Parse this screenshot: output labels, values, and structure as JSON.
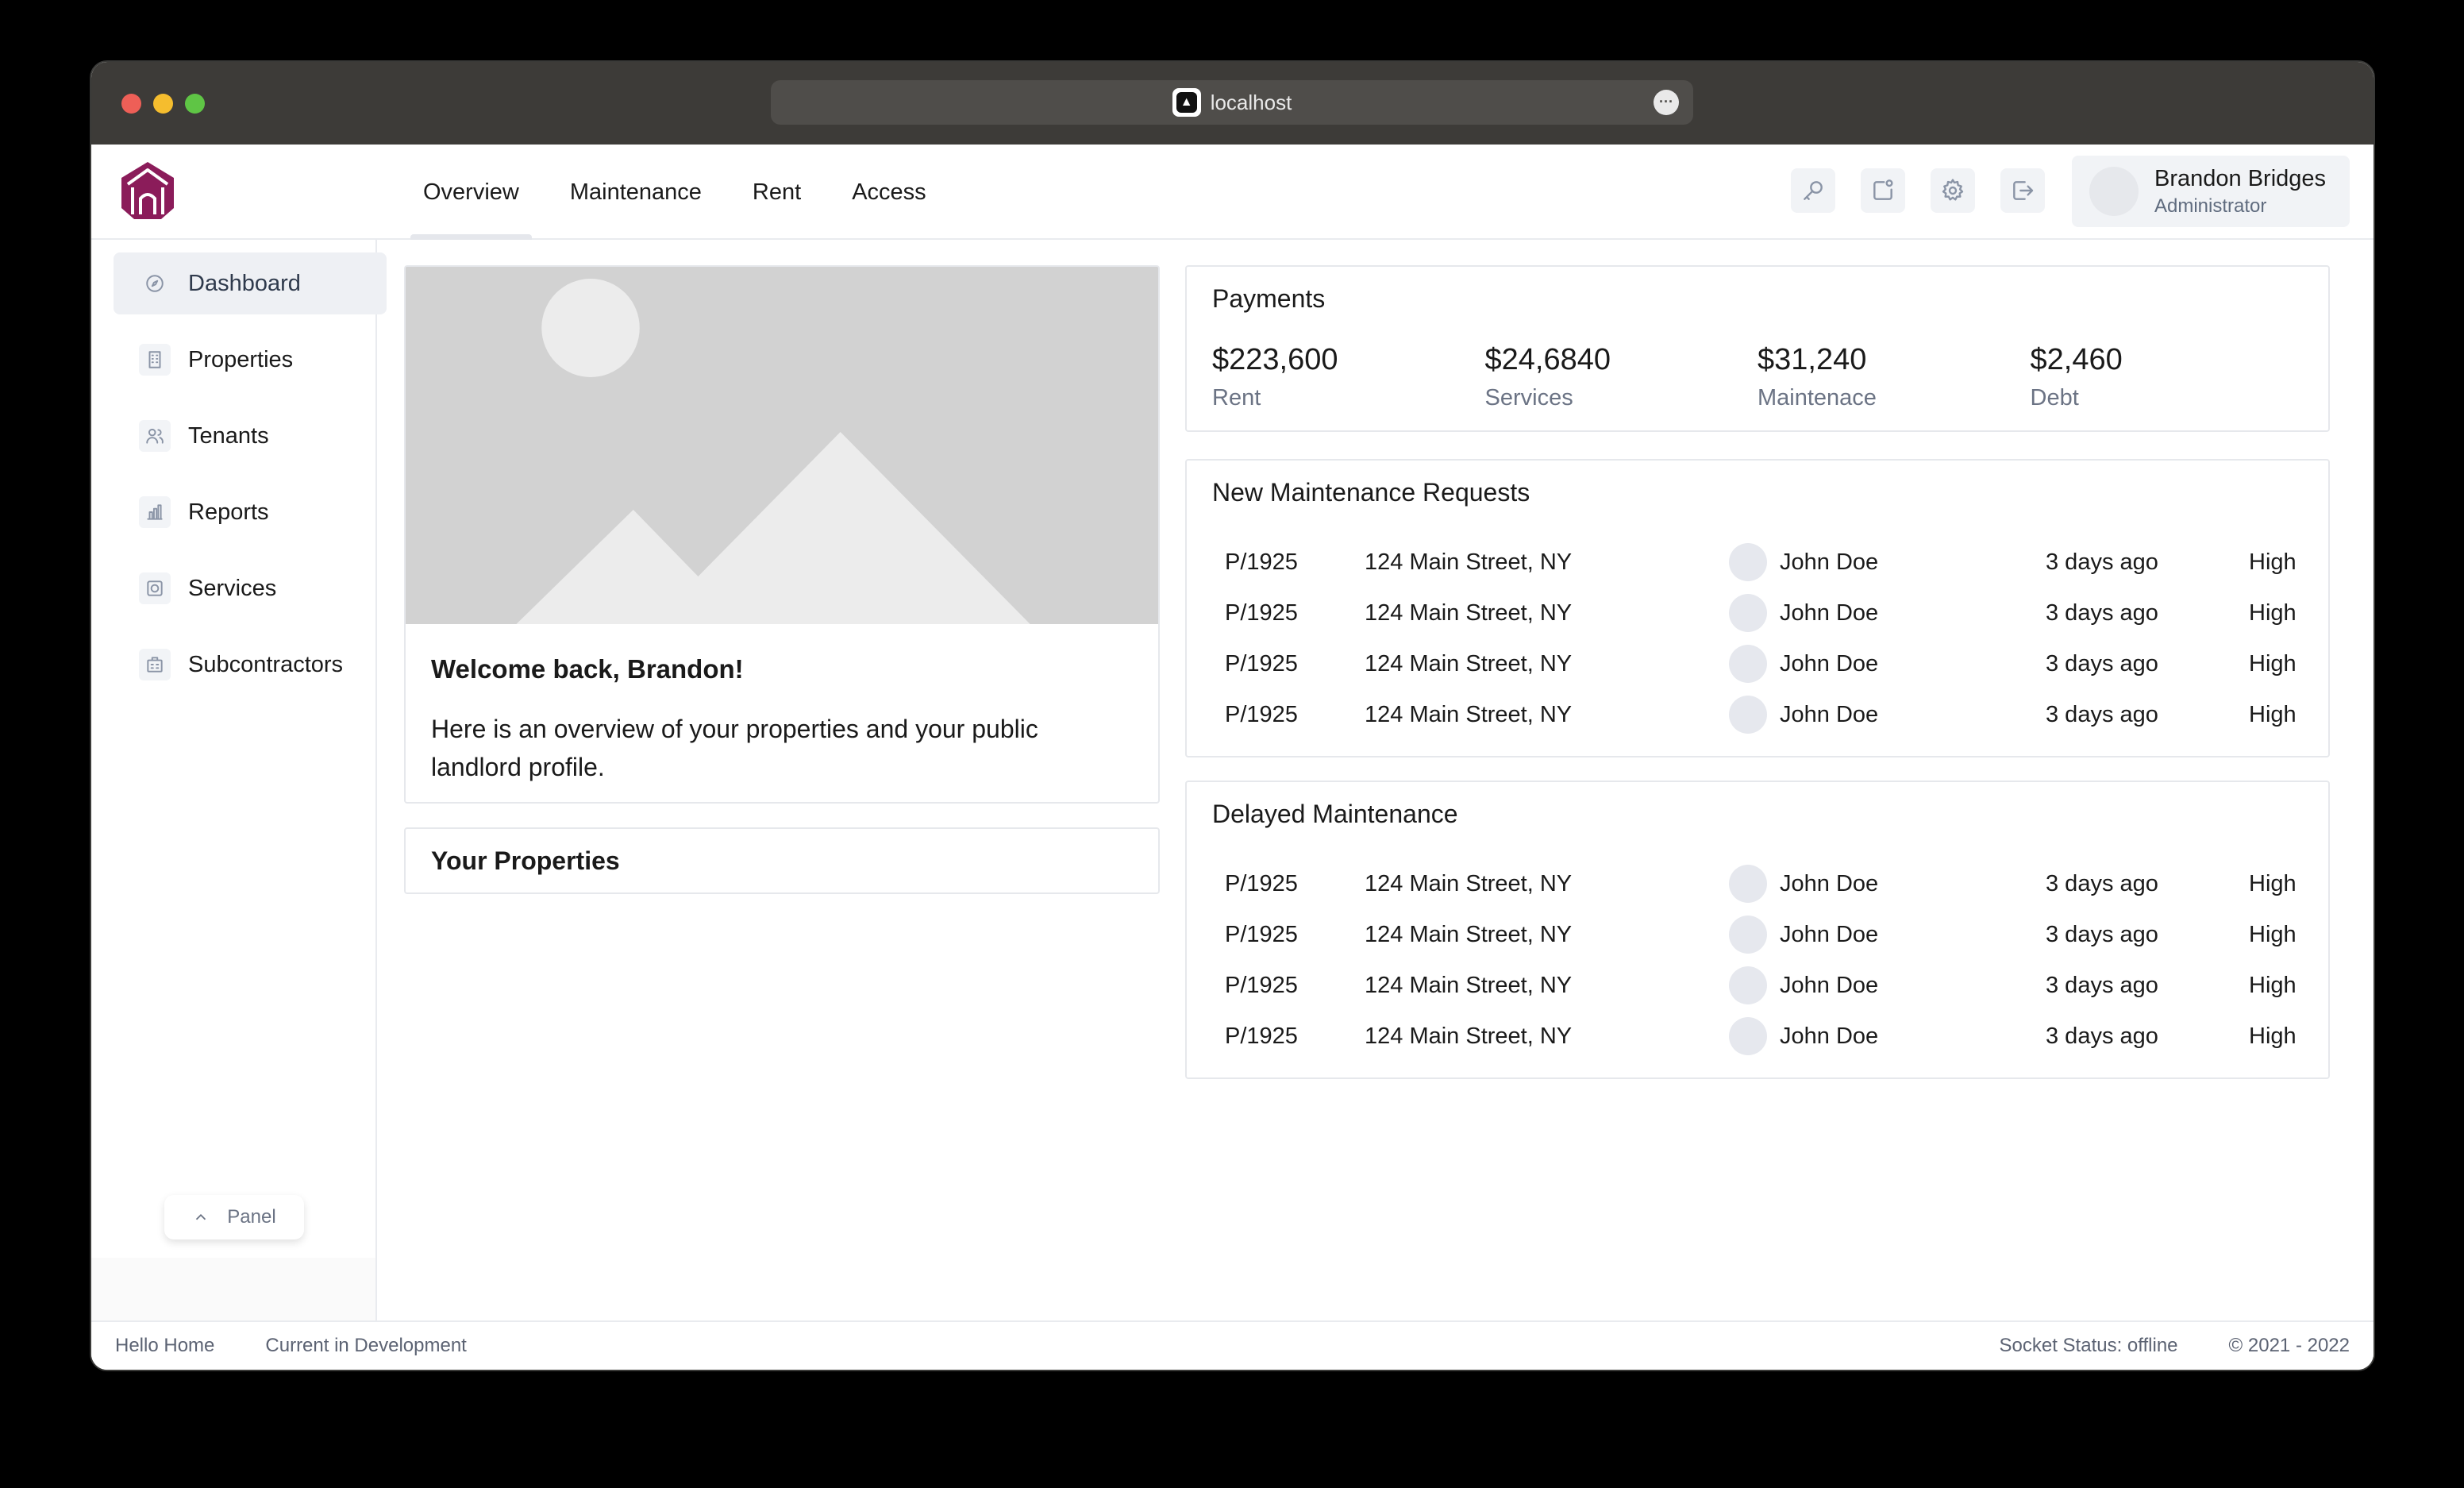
{
  "browser": {
    "url": "localhost"
  },
  "nav": {
    "tabs": [
      {
        "label": "Overview"
      },
      {
        "label": "Maintenance"
      },
      {
        "label": "Rent"
      },
      {
        "label": "Access"
      }
    ],
    "icons": [
      "key-icon",
      "share-icon",
      "gear-icon",
      "logout-icon"
    ]
  },
  "user": {
    "name": "Brandon Bridges",
    "role": "Administrator"
  },
  "sidebar": {
    "items": [
      {
        "label": "Dashboard",
        "icon": "compass-icon"
      },
      {
        "label": "Properties",
        "icon": "building-icon"
      },
      {
        "label": "Tenants",
        "icon": "users-icon"
      },
      {
        "label": "Reports",
        "icon": "chart-icon"
      },
      {
        "label": "Services",
        "icon": "services-icon"
      },
      {
        "label": "Subcontractors",
        "icon": "briefcase-icon"
      }
    ],
    "panel_label": "Panel"
  },
  "welcome": {
    "title": "Welcome back, Brandon!",
    "text": "Here is an overview of your properties and your public landlord profile."
  },
  "your_properties": {
    "title": "Your Properties"
  },
  "payments": {
    "title": "Payments",
    "items": [
      {
        "amount": "$223,600",
        "label": "Rent"
      },
      {
        "amount": "$24,6840",
        "label": "Services"
      },
      {
        "amount": "$31,240",
        "label": "Maintenace"
      },
      {
        "amount": "$2,460",
        "label": "Debt"
      }
    ]
  },
  "new_requests": {
    "title": "New Maintenance Requests",
    "rows": [
      {
        "id": "P/1925",
        "address": "124 Main Street, NY",
        "name": "John Doe",
        "time": "3 days ago",
        "priority": "High"
      },
      {
        "id": "P/1925",
        "address": "124 Main Street, NY",
        "name": "John Doe",
        "time": "3 days ago",
        "priority": "High"
      },
      {
        "id": "P/1925",
        "address": "124 Main Street, NY",
        "name": "John Doe",
        "time": "3 days ago",
        "priority": "High"
      },
      {
        "id": "P/1925",
        "address": "124 Main Street, NY",
        "name": "John Doe",
        "time": "3 days ago",
        "priority": "High"
      }
    ]
  },
  "delayed": {
    "title": "Delayed Maintenance",
    "rows": [
      {
        "id": "P/1925",
        "address": "124 Main Street, NY",
        "name": "John Doe",
        "time": "3 days ago",
        "priority": "High"
      },
      {
        "id": "P/1925",
        "address": "124 Main Street, NY",
        "name": "John Doe",
        "time": "3 days ago",
        "priority": "High"
      },
      {
        "id": "P/1925",
        "address": "124 Main Street, NY",
        "name": "John Doe",
        "time": "3 days ago",
        "priority": "High"
      },
      {
        "id": "P/1925",
        "address": "124 Main Street, NY",
        "name": "John Doe",
        "time": "3 days ago",
        "priority": "High"
      }
    ]
  },
  "footer": {
    "left": [
      "Hello Home",
      "Current in Development"
    ],
    "socket_status": "Socket Status: offline",
    "copyright": "© 2021 - 2022"
  },
  "colors": {
    "brand": "#8b1c5a",
    "active_bg": "#eef0f4",
    "border": "#e6e8ec"
  }
}
